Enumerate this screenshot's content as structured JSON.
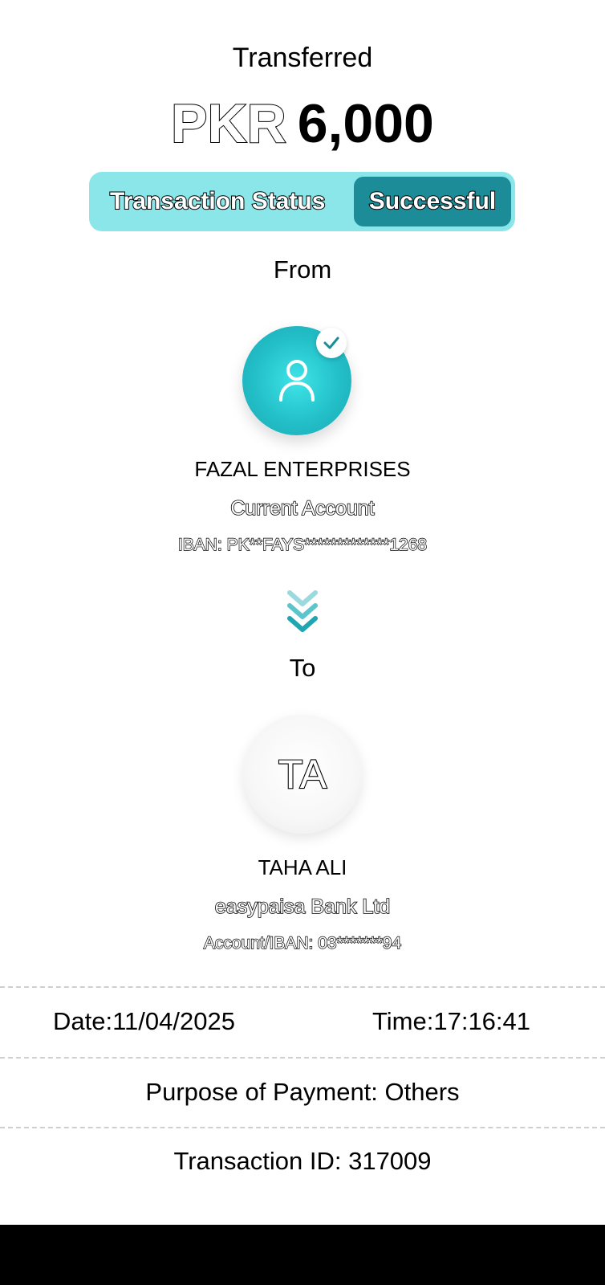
{
  "receipt": {
    "heading": "Transferred",
    "currency": "PKR",
    "amount": "6,000",
    "status": {
      "label": "Transaction Status",
      "value": "Successful"
    },
    "from": {
      "section_label": "From",
      "avatar_icon": "user-icon",
      "verified_icon": "check-icon",
      "name": "FAZAL ENTERPRISES",
      "account_type": "Current Account",
      "iban": "IBAN: PK**FAYS*************1268"
    },
    "transfer_icon": "double-chevron-down-icon",
    "to": {
      "section_label": "To",
      "initials": "TA",
      "name": "TAHA ALI",
      "bank": "easypaisa Bank Ltd",
      "account": "Account/IBAN: 03*******94"
    },
    "date": "Date:11/04/2025",
    "time": "Time:17:16:41",
    "purpose": "Purpose of Payment: Others",
    "transaction_id": "Transaction ID: 317009"
  },
  "colors": {
    "accent_light": "#8ae6e8",
    "accent_dark": "#1c8d98",
    "avatar_teal": "#23bfc8",
    "divider": "#cfcfcf"
  }
}
